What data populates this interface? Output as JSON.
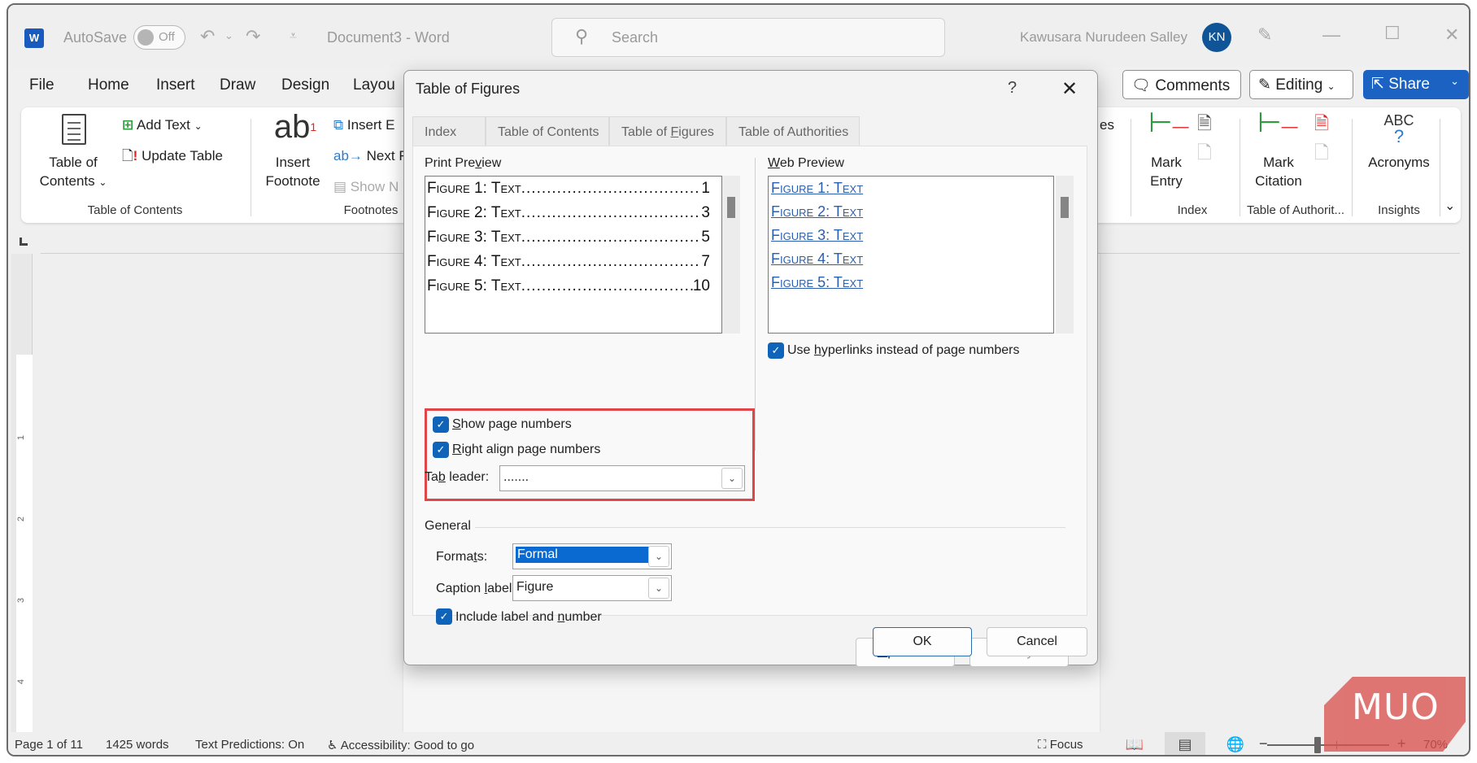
{
  "titlebar": {
    "app_logo": "W",
    "autosave_label": "AutoSave",
    "autosave_state": "Off",
    "document_title": "Document3  -  Word",
    "search_placeholder": "Search",
    "user_name": "Kawusara Nurudeen Salley",
    "user_initials": "KN",
    "icons": [
      "undo-icon",
      "redo-icon",
      "customize-toolbar-icon",
      "search-icon",
      "designer-icon",
      "minimize-icon",
      "maximize-icon",
      "close-icon"
    ]
  },
  "menu": {
    "tabs": [
      "File",
      "Home",
      "Insert",
      "Draw",
      "Design",
      "Layou"
    ],
    "comments_label": "Comments",
    "editing_label": "Editing",
    "share_label": "Share"
  },
  "ribbon": {
    "toc_button": [
      "Table of",
      "Contents"
    ],
    "add_text": "Add Text",
    "update_table": "Update Table",
    "toc_group": "Table of Contents",
    "insert_footnote": [
      "Insert",
      "Footnote"
    ],
    "insert_endnote": "Insert E",
    "next_footnote": "Next Fo",
    "show_notes": "Show N",
    "footnotes_group": "Footnotes",
    "captions_partial": "es",
    "mark_entry": [
      "Mark",
      "Entry"
    ],
    "index_group": "Index",
    "mark_citation": [
      "Mark",
      "Citation"
    ],
    "toa_group": "Table of Authorit...",
    "acronyms_icon_text": "ABC",
    "acronyms": "Acronyms",
    "insights_group": "Insights"
  },
  "dialog": {
    "title": "Table of Figures",
    "help": "?",
    "tabs": [
      {
        "label": "Index",
        "active": false
      },
      {
        "label": "Table of Contents",
        "active": false
      },
      {
        "label": "Table of Figures",
        "active": true
      },
      {
        "label": "Table of Authorities",
        "active": false
      }
    ],
    "print_preview": {
      "label": "Print Preview",
      "rows": [
        {
          "caption": "Figure 1: Text",
          "page": "1"
        },
        {
          "caption": "Figure 2: Text",
          "page": "3"
        },
        {
          "caption": "Figure 3: Text",
          "page": "5"
        },
        {
          "caption": "Figure 4: Text",
          "page": "7"
        },
        {
          "caption": "Figure 5: Text",
          "page": "10"
        }
      ]
    },
    "web_preview": {
      "label": "Web Preview",
      "rows": [
        "Figure 1: Text",
        "Figure 2: Text",
        "Figure 3: Text",
        "Figure 4: Text",
        "Figure 5: Text"
      ]
    },
    "show_page_numbers": {
      "label": "Show page numbers",
      "checked": true
    },
    "right_align": {
      "label": "Right align page numbers",
      "checked": true
    },
    "tab_leader": {
      "label": "Tab leader:",
      "value": "......."
    },
    "use_hyperlinks": {
      "label": "Use hyperlinks instead of page numbers",
      "checked": true
    },
    "general_label": "General",
    "formats": {
      "label": "Formats:",
      "value": "Formal"
    },
    "caption_label": {
      "label": "Caption label:",
      "value": "Figure"
    },
    "include_label": {
      "label": "Include label and number",
      "checked": true
    },
    "options_button": "Options...",
    "modify_button": "Modify...",
    "ok_button": "OK",
    "cancel_button": "Cancel",
    "highlight_color": "#e0454a"
  },
  "ruler": {
    "numbers": [
      "1",
      "2",
      "3",
      "4"
    ]
  },
  "statusbar": {
    "page": "Page 1 of 11",
    "words": "1425 words",
    "predictions": "Text Predictions: On",
    "accessibility": "Accessibility: Good to go",
    "focus": "Focus",
    "zoom_minus": "−",
    "zoom_plus": "+",
    "zoom_level": "70%"
  },
  "watermark": "MUO",
  "colors": {
    "accent": "#1b62c2",
    "checkbox": "#0f63b8",
    "hyperlink": "#2a5fb0"
  }
}
